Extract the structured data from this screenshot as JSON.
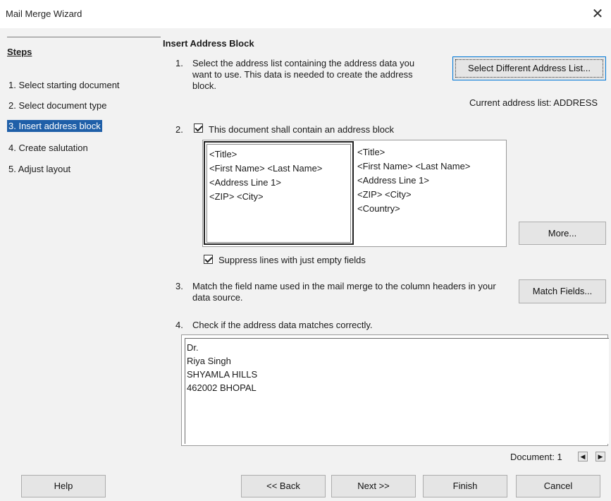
{
  "window": {
    "title": "Mail Merge Wizard",
    "close_label": "✕"
  },
  "steps": {
    "heading": "Steps",
    "items": [
      {
        "label": "1. Select starting document"
      },
      {
        "label": "2. Select document type"
      },
      {
        "label": "3. Insert address block",
        "active": true
      },
      {
        "label": "4. Create salutation"
      },
      {
        "label": "5. Adjust layout"
      }
    ]
  },
  "main": {
    "title": "Insert Address Block",
    "step1": {
      "num": "1.",
      "text": "Select the address list containing the address data you want to use. This data is needed to create the address block.",
      "button": "Select Different Address List...",
      "current_list": "Current address list: ADDRESS"
    },
    "step2": {
      "num": "2.",
      "checkbox_label": "This document shall contain an address block",
      "checked": true,
      "block1": [
        "<Title>",
        "<First Name> <Last Name>",
        "<Address Line 1>",
        "<ZIP> <City>"
      ],
      "block2": [
        "<Title>",
        "<First Name> <Last Name>",
        "<Address Line 1>",
        "<ZIP> <City>",
        "<Country>"
      ],
      "more_button": "More...",
      "suppress_label": "Suppress lines with just empty fields",
      "suppress_checked": true
    },
    "step3": {
      "num": "3.",
      "text": "Match the field name used in the mail merge to the column headers in your data source.",
      "button": "Match Fields..."
    },
    "step4": {
      "num": "4.",
      "text": "Check if the address data matches correctly.",
      "preview": [
        "Dr.",
        "Riya Singh",
        "SHYAMLA HILLS",
        "462002 BHOPAL"
      ],
      "document_label": "Document: 1"
    }
  },
  "footer": {
    "help": "Help",
    "back": "<< Back",
    "next": "Next >>",
    "finish": "Finish",
    "cancel": "Cancel"
  }
}
